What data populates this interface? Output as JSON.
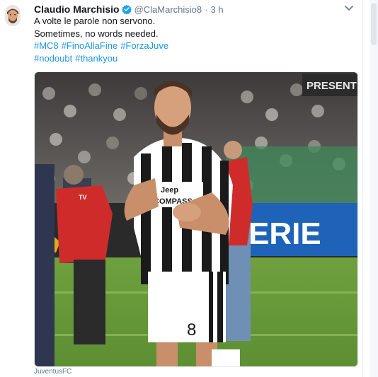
{
  "tweet": {
    "author": {
      "display_name": "Claudio Marchisio",
      "handle": "@ClaMarchisio8",
      "verified": true,
      "avatar_icon": "player-avatar"
    },
    "separator": "·",
    "time": "3 h",
    "lines": [
      "A volte le parole non servono.",
      "Sometimes, no words needed."
    ],
    "hashtags_row1": [
      "#MC8",
      "#FinoAllaFine",
      "#ForzaJuve"
    ],
    "hashtags_row2": [
      "#nodoubt",
      "#thankyou"
    ],
    "media": {
      "kind": "photo",
      "shirt_sponsor": "Jeep",
      "shirt_sponsor_sub": "COMPASS",
      "shirt_number": "8",
      "banner_text": "ERIE",
      "banner_text_top": "PRESENT"
    },
    "media_source": "JuventusFC",
    "menu_icon": "chevron-down-icon"
  },
  "colors": {
    "link": "#1b95e0",
    "text": "#14171a",
    "secondary": "#657786",
    "verified": "#1da1f2"
  }
}
